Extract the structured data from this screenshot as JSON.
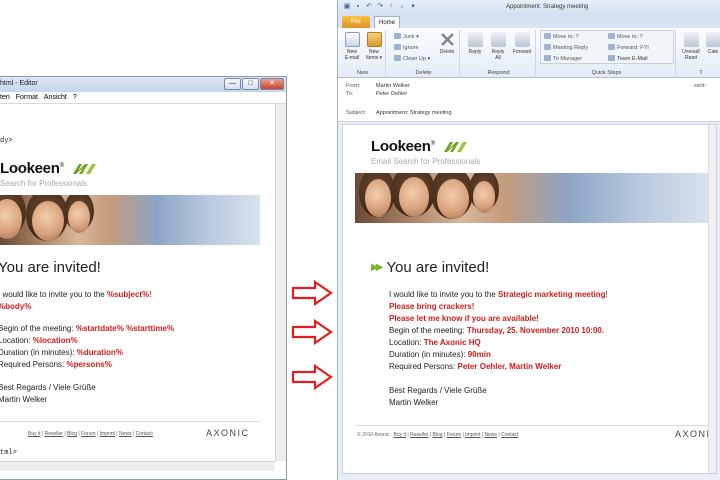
{
  "editor": {
    "title": "html - Editor",
    "menu": [
      {
        "label": "Bearbeiten",
        "visible": "ten"
      },
      {
        "label": "Format",
        "visible": "Format"
      },
      {
        "label": "Ansicht",
        "visible": "Ansicht"
      },
      {
        "label": "?",
        "visible": "?"
      }
    ],
    "buttons": {
      "minimize": "—",
      "maximize": "□",
      "close": "✕"
    },
    "code_top": "dy>",
    "code_bottom": "tml>",
    "template": {
      "logo": "Lookeen",
      "logo_mark": "®",
      "tagline": "Search for Professionals",
      "heading": "You are invited!",
      "intro_prefix": "I would like to invite you to the ",
      "subject": "%subject%",
      "intro_suffix": "!",
      "body": "%body%",
      "begin_label": "Begin of the meeting: ",
      "begin_value": "%startdate% %starttime%",
      "location_label": "Location: ",
      "location_value": "%location%",
      "duration_label": "Duration (in minutes): ",
      "duration_value": "%duration%",
      "persons_label": "Required Persons: ",
      "persons_value": "%persons%",
      "regards": "Best Regards / Viele Grüße",
      "sender": "Martin Welker",
      "footer_links": [
        "Buy it",
        "Reseller",
        "Blog",
        "Forum",
        "Imprint",
        "News",
        "Contact"
      ],
      "brand": "AXONIC"
    }
  },
  "outlook": {
    "window_title": "Appointment: Strategy meeting",
    "file_tab": "File",
    "home_tab": "Home",
    "ribbon": {
      "new_email": "New\nE-mail",
      "new_items": "New\nItems ▾",
      "new_group": "New",
      "junk": "Junk ▾",
      "ignore": "Ignore",
      "cleanup": "Clean Up ▾",
      "delete": "Delete",
      "delete_group": "Delete",
      "reply": "Reply",
      "reply_all": "Reply\nAll",
      "forward": "Forward",
      "respond_group": "Respond",
      "qs_move": "Move to: ?",
      "qs_meeting": "Meeting Reply",
      "qs_manager": "To Manager",
      "qs_forward": "Forward: FYI",
      "qs_team": "Team E-Mail",
      "qs_group": "Quick Steps",
      "unread": "Unread/\nRead",
      "categorize": "Cate",
      "tags_group": "T"
    },
    "header": {
      "from_label": "From:",
      "from_value": "Martin Welker",
      "to_label": "To:",
      "to_value": "Peter Oehler",
      "subject_label": "Subject:",
      "subject_value": "Appointment: Strategy meeting",
      "sent_label": "sent:"
    },
    "email": {
      "logo": "Lookeen",
      "logo_mark": "®",
      "tagline": "Email Search for Professionals",
      "heading": "You are invited!",
      "intro_prefix": "I would like to invite you to the ",
      "subject": "Strategic marketing meeting",
      "intro_suffix": "!",
      "body_line1": "Please bring crackers!",
      "body_line2": "Please let me know if you are available!",
      "begin_label": "Begin of the meeting: ",
      "begin_value": "Thursday, 25. November 2010 10:00.",
      "location_label": "Location: ",
      "location_value": "The Axonic HQ",
      "duration_label": "Duration (in minutes): ",
      "duration_value": "90min",
      "persons_label": "Required Persons: ",
      "persons_value": "Peter Oehler, Martin Welker",
      "regards": "Best Regards / Viele Grüße",
      "sender": "Martin Welker",
      "copyright": "© 2010 Axonic",
      "footer_links": [
        "Buy it",
        "Reseller",
        "Blog",
        "Forum",
        "Imprint",
        "News",
        "Contact"
      ],
      "brand": "AXONIC"
    }
  },
  "colors": {
    "placeholder_red": "#d11b1b",
    "accent_green": "#7cb82f",
    "arrow_red": "#e02020",
    "file_tab": "#e8a12e"
  },
  "arrows": [
    "arrow-right-icon",
    "arrow-right-icon",
    "arrow-right-icon"
  ]
}
